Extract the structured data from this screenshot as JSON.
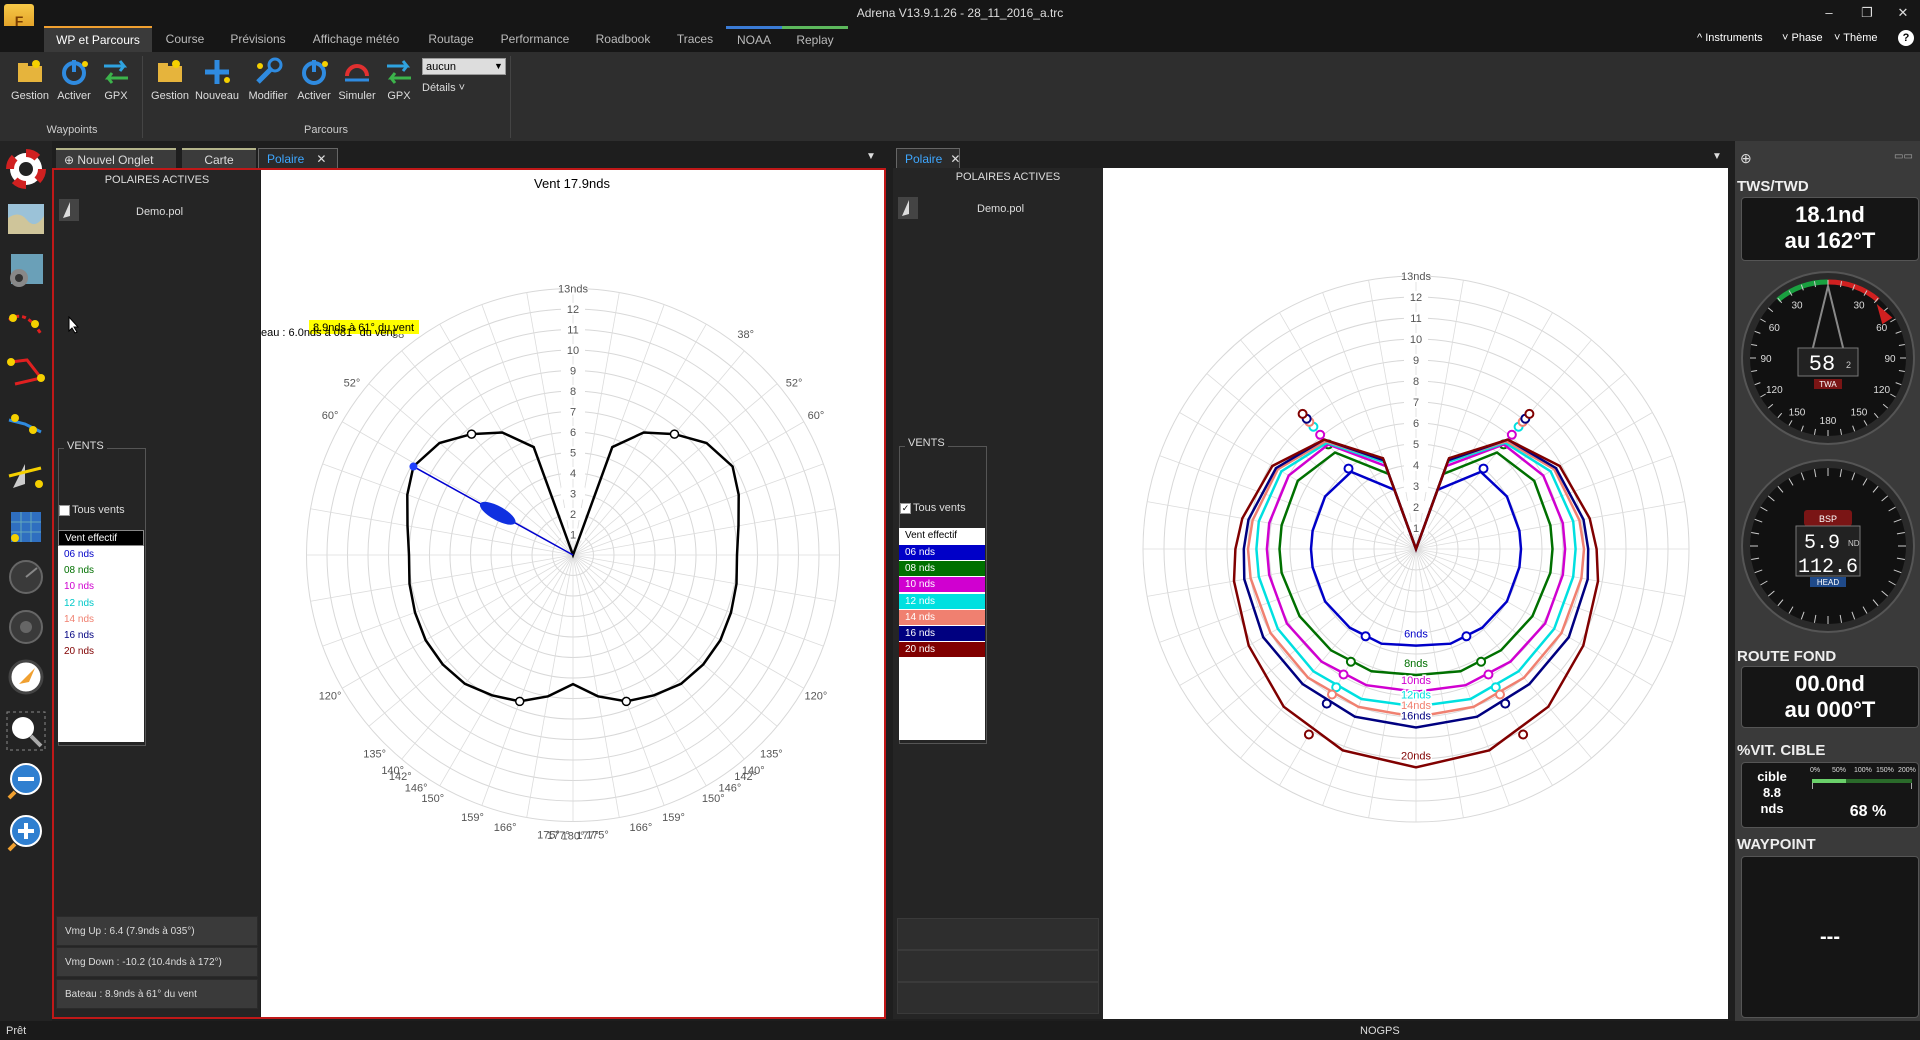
{
  "window": {
    "title": "Adrena V13.9.1.26 - 28_11_2016_a.trc",
    "logo": "F",
    "minimize": "–",
    "restore": "❐",
    "close": "✕"
  },
  "menu": {
    "tabs": [
      "WP et Parcours",
      "Course",
      "Prévisions",
      "Affichage météo",
      "Routage",
      "Performance",
      "Roadbook",
      "Traces",
      "NOAA",
      "Replay"
    ],
    "right": {
      "instruments": "Instruments",
      "phase": "Phase",
      "theme": "Thème",
      "help": "?"
    }
  },
  "ribbon": {
    "waypoints": {
      "group": "Waypoints",
      "buttons": [
        "Gestion",
        "Activer",
        "GPX"
      ]
    },
    "parcours": {
      "group": "Parcours",
      "buttons": [
        "Gestion",
        "Nouveau",
        "Modifier",
        "Activer",
        "Simuler",
        "GPX"
      ]
    },
    "select_value": "aucun",
    "details": "Détails"
  },
  "left_tabs": [
    "Nouvel Onglet",
    "Carte",
    "Polaire"
  ],
  "right_tabs": [
    "Polaire"
  ],
  "left_pane": {
    "polaires_title": "POLAIRES ACTIVES",
    "file": "Demo.pol",
    "vents_title": "VENTS",
    "tous_vents": "Tous vents",
    "tous_vents_checked": false,
    "wind_header": "Vent effectif",
    "winds": [
      {
        "label": "06 nds",
        "color": "#0000c8"
      },
      {
        "label": "08 nds",
        "color": "#007000"
      },
      {
        "label": "10 nds",
        "color": "#d000d0"
      },
      {
        "label": "12 nds",
        "color": "#00c8c8"
      },
      {
        "label": "14 nds",
        "color": "#f08070"
      },
      {
        "label": "16 nds",
        "color": "#000080"
      },
      {
        "label": "20 nds",
        "color": "#800000"
      }
    ],
    "vmg_up": "Vmg Up : 6.4 (7.9nds à 035°)",
    "vmg_down": "Vmg Down : -10.2 (10.4nds à 172°)",
    "bateau": "Bateau : 8.9nds à  61° du vent",
    "chart_title": "Vent 17.9nds",
    "tooltip": "8.9nds à  61° du vent",
    "cut_label": "eau : 6.0nds à 081° du vent"
  },
  "right_pane": {
    "polaires_title": "POLAIRES ACTIVES",
    "file": "Demo.pol",
    "vents_title": "VENTS",
    "tous_vents": "Tous vents",
    "tous_vents_checked": true,
    "wind_header": "Vent effectif",
    "winds": [
      {
        "label": "06 nds",
        "color": "#0000c8"
      },
      {
        "label": "08 nds",
        "color": "#007000"
      },
      {
        "label": "10 nds",
        "color": "#d000d0"
      },
      {
        "label": "12 nds",
        "color": "#00e0e0"
      },
      {
        "label": "14 nds",
        "color": "#f08070"
      },
      {
        "label": "16 nds",
        "color": "#000080"
      },
      {
        "label": "20 nds",
        "color": "#800000"
      }
    ],
    "curve_labels": [
      "6nds",
      "8nds",
      "10nds",
      "12nds",
      "14nds",
      "16nds",
      "20nds"
    ]
  },
  "chart_data": [
    {
      "type": "line",
      "polar": true,
      "title": "Vent 17.9nds",
      "radial_ticks": [
        "1",
        "2",
        "3",
        "4",
        "5",
        "6",
        "7",
        "8",
        "9",
        "10",
        "11",
        "12",
        "13nds"
      ],
      "angle_labels": [
        "38°",
        "52°",
        "60°",
        "120°",
        "135°",
        "140°",
        "142°",
        "146°",
        "150°",
        "159°",
        "166°",
        "175°",
        "177°",
        "180°"
      ],
      "series": [
        {
          "name": "Vent 17.9nds",
          "color": "#000000",
          "angles": [
            0,
            20,
            30,
            40,
            50,
            61,
            70,
            80,
            90,
            100,
            110,
            120,
            130,
            140,
            150,
            160,
            170,
            180
          ],
          "speeds": [
            0,
            5.6,
            6.9,
            7.7,
            8.5,
            8.9,
            8.6,
            8.2,
            8.0,
            8.1,
            8.2,
            8.3,
            8.3,
            8.2,
            7.9,
            7.6,
            7.0,
            6.3
          ]
        }
      ],
      "highlight": {
        "angle": 61,
        "speed": 8.9
      }
    },
    {
      "type": "line",
      "polar": true,
      "radial_ticks": [
        "1",
        "2",
        "3",
        "4",
        "5",
        "6",
        "7",
        "8",
        "9",
        "10",
        "11",
        "12",
        "13nds"
      ],
      "series": [
        {
          "name": "6nds",
          "color": "#0000c8",
          "angles": [
            0,
            20,
            40,
            60,
            80,
            90,
            100,
            120,
            140,
            160,
            180
          ],
          "speeds": [
            0,
            3.0,
            4.8,
            5.0,
            5.0,
            5.0,
            5.0,
            5.0,
            4.9,
            4.8,
            4.6
          ]
        },
        {
          "name": "8nds",
          "color": "#007000",
          "angles": [
            0,
            20,
            40,
            60,
            80,
            90,
            100,
            120,
            140,
            160,
            180
          ],
          "speeds": [
            0,
            3.8,
            6.0,
            6.5,
            6.5,
            6.5,
            6.5,
            6.4,
            6.3,
            6.2,
            6.0
          ]
        },
        {
          "name": "10nds",
          "color": "#d000d0",
          "angles": [
            0,
            20,
            40,
            60,
            80,
            90,
            100,
            120,
            140,
            160,
            180
          ],
          "speeds": [
            0,
            4.2,
            6.5,
            7.0,
            7.1,
            7.1,
            7.1,
            7.1,
            7.0,
            6.9,
            6.8
          ]
        },
        {
          "name": "12nds",
          "color": "#00e0e0",
          "angles": [
            0,
            20,
            40,
            60,
            80,
            90,
            100,
            120,
            140,
            160,
            180
          ],
          "speeds": [
            0,
            4.4,
            6.6,
            7.4,
            7.6,
            7.6,
            7.6,
            7.6,
            7.6,
            7.6,
            7.5
          ]
        },
        {
          "name": "14nds",
          "color": "#f08070",
          "angles": [
            0,
            20,
            40,
            60,
            80,
            90,
            100,
            120,
            140,
            160,
            180
          ],
          "speeds": [
            0,
            4.5,
            6.7,
            7.6,
            7.9,
            8.0,
            8.0,
            8.0,
            8.0,
            8.0,
            8.0
          ]
        },
        {
          "name": "16nds",
          "color": "#000080",
          "angles": [
            0,
            20,
            40,
            60,
            80,
            90,
            100,
            120,
            140,
            160,
            180
          ],
          "speeds": [
            0,
            4.5,
            6.8,
            7.7,
            8.1,
            8.2,
            8.3,
            8.4,
            8.4,
            8.5,
            8.5
          ]
        },
        {
          "name": "20nds",
          "color": "#800000",
          "angles": [
            0,
            20,
            40,
            60,
            80,
            90,
            100,
            120,
            140,
            160,
            180
          ],
          "speeds": [
            0,
            4.6,
            6.8,
            7.9,
            8.4,
            8.6,
            8.8,
            9.2,
            9.8,
            10.2,
            10.4
          ]
        }
      ]
    }
  ],
  "instruments": {
    "tws_title": "TWS/TWD",
    "tws_value": "18.1nd",
    "twd_value": "au 162°T",
    "twa_value": "58",
    "twa_unit": "2",
    "twa_label": "TWA",
    "twa_ticks": [
      "30",
      "60",
      "90",
      "120",
      "150",
      "180",
      "150",
      "120",
      "90",
      "60",
      "30"
    ],
    "bsp_label": "BSP",
    "head_label": "HEAD",
    "bsp_value": "5.9",
    "bsp_unit": "ND",
    "head_value": "112.6",
    "cog_title": "ROUTE FOND",
    "cog_speed": "00.0nd",
    "cog_dir": "au 000°T",
    "target_title": "%VIT. CIBLE",
    "target_label": "cible",
    "target_value": "8.8",
    "target_unit": "nds",
    "target_scale": [
      "0%",
      "50%",
      "100%",
      "150%",
      "200%"
    ],
    "target_pct": "68 %",
    "target_fraction": 0.68,
    "waypoint_title": "WAYPOINT",
    "waypoint_value": "---"
  },
  "status": {
    "left": "Prêt",
    "center": "NOGPS"
  }
}
